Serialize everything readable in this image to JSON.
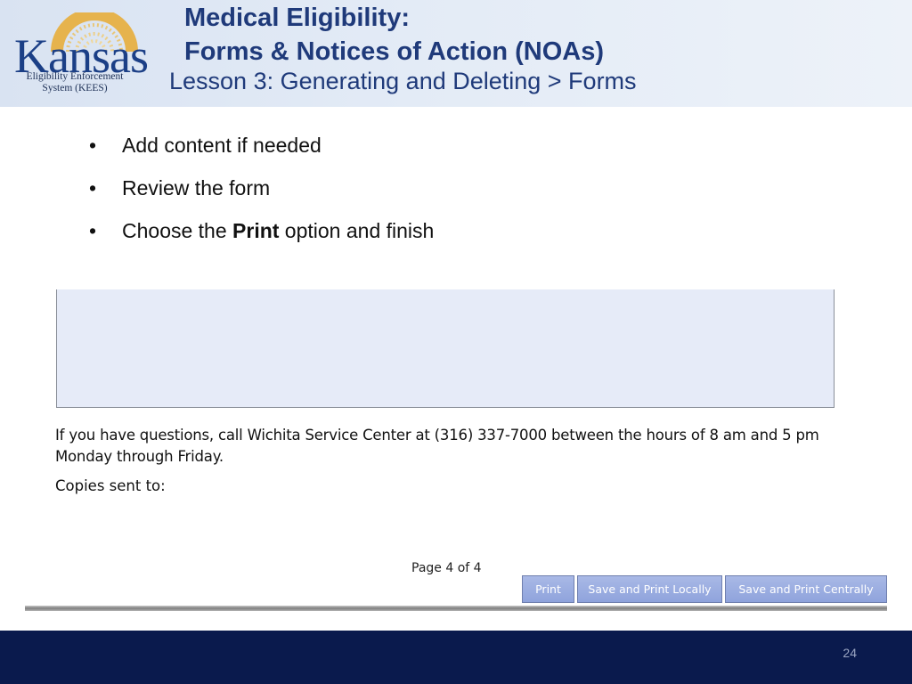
{
  "header": {
    "logo": {
      "wordmark": "Kansas",
      "arc_text": "AD ASTRA PER ASPERA",
      "subtitle_line1": "Eligibility Enforcement",
      "subtitle_line2": "System (KEES)"
    },
    "title_line1": "Medical Eligibility:",
    "title_line2": "Forms & Notices of Action (NOAs)",
    "subtitle": "Lesson 3: Generating and Deleting  > Forms"
  },
  "bullets": [
    {
      "text": "Add content if needed"
    },
    {
      "text": "Review the form"
    },
    {
      "prefix": "Choose the ",
      "bold": "Print",
      "suffix": " option and finish"
    }
  ],
  "bullet_glyph": "•",
  "form": {
    "info_line": "If you have questions, call  Wichita Service Center at  (316) 337-7000 between the hours of 8 am and 5 pm Monday through Friday.",
    "copies_label": "Copies sent to:",
    "page_indicator": "Page 4 of 4",
    "buttons": {
      "print": "Print",
      "save_print_locally": "Save and Print Locally",
      "save_print_centrally": "Save and Print Centrally"
    }
  },
  "footer": {
    "slide_number": "24"
  },
  "colors": {
    "title": "#1f3a7a",
    "footer_bg": "#0a1a4d",
    "button_bg": "#9aace0",
    "form_box_bg": "#e6ebf8"
  }
}
